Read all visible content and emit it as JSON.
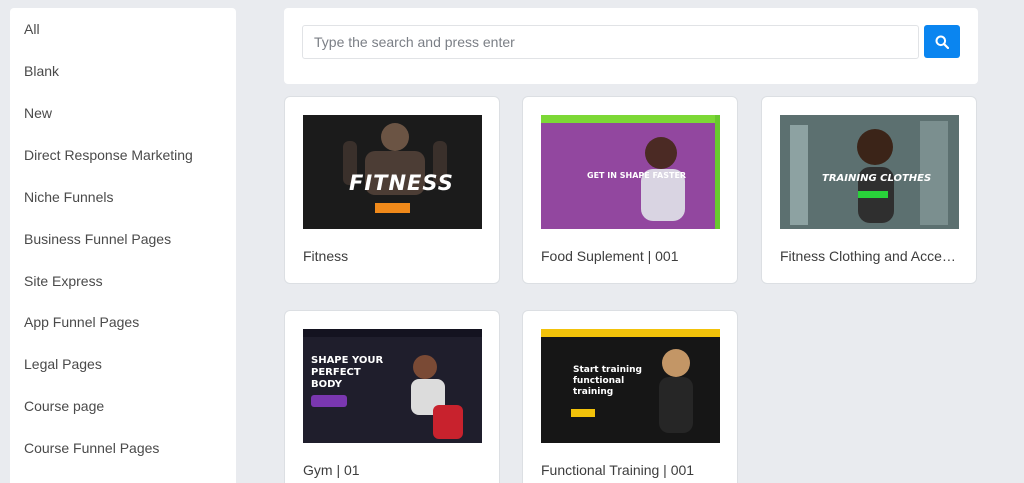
{
  "sidebar": {
    "items": [
      {
        "label": "All"
      },
      {
        "label": "Blank"
      },
      {
        "label": "New"
      },
      {
        "label": "Direct Response Marketing"
      },
      {
        "label": "Niche Funnels"
      },
      {
        "label": "Business Funnel Pages"
      },
      {
        "label": "Site Express"
      },
      {
        "label": "App Funnel Pages"
      },
      {
        "label": "Legal Pages"
      },
      {
        "label": "Course page"
      },
      {
        "label": "Course Funnel Pages"
      }
    ]
  },
  "search": {
    "placeholder": "Type the search and press enter",
    "value": "",
    "button_icon": "search-icon",
    "button_color": "#0a85f0"
  },
  "templates": [
    {
      "title": "Fitness",
      "thumb_heading": "FITNESS"
    },
    {
      "title": "Food Suplement | 001",
      "thumb_heading": "GET IN SHAPE FASTER"
    },
    {
      "title": "Fitness Clothing and Accessories",
      "thumb_heading": "TRAINING CLOTHES"
    },
    {
      "title": "Gym | 01",
      "thumb_heading": "SHAPE YOUR PERFECT BODY"
    },
    {
      "title": "Functional Training | 001",
      "thumb_heading": "Start training functional training"
    }
  ]
}
